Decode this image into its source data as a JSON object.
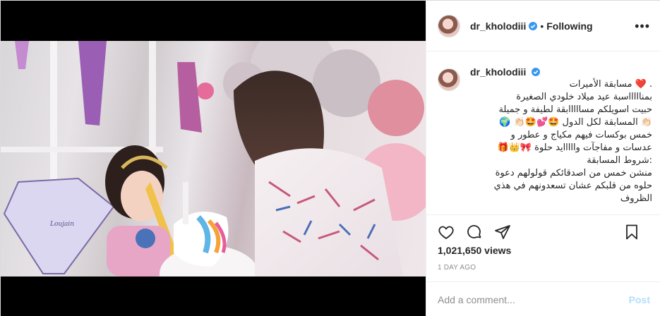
{
  "post": {
    "username": "dr_kholodiii",
    "follow_state": "Following",
    "more_label": "•••",
    "caption_user": "dr_kholodiii",
    "caption_text": ". ❤️ مسابقة الأميرات\nبمناااااسبة عيد ميلاد خلودي الصغيرة\nحبيت اسويلكم مسااااابقة لطيفة و جميلة\n👏🏻 المسابقة لكل الدول 🤩💕🤩👏🏻 🌍\nخمس بوكسات فيهم مكياج و عطور و\nعدسات و مفاجآت وااااايد حلوة 🎀👑🎁\n:شروط المسابقة\nمنشن خمس من اصدقائكم قولولهم دعوة\nحلوه من قلبكم عشان تسعدونهم في هذي\nالظروف",
    "views": "1,021,650 views",
    "time_ago": "1 DAY AGO",
    "comment_placeholder": "Add a comment...",
    "post_button": "Post"
  },
  "media": {
    "label": "Loujain"
  },
  "colors": {
    "verified": "#3897f0",
    "post_disabled": "#b2dffc"
  },
  "icons": [
    "more-icon",
    "verified-icon",
    "heart-icon",
    "comment-icon",
    "share-icon",
    "bookmark-icon"
  ]
}
